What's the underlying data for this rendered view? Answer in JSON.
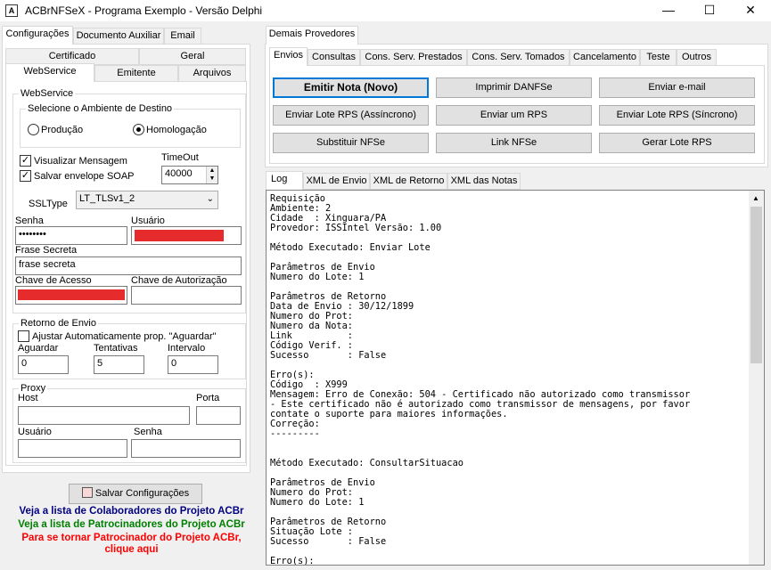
{
  "window": {
    "title": "ACBrNFSeX - Programa Exemplo - Versão Delphi",
    "icon": "app-icon"
  },
  "left": {
    "top_tabs": [
      "Configurações",
      "Documento Auxiliar",
      "Email"
    ],
    "sub_tabs_row1": [
      "Certificado",
      "Geral"
    ],
    "sub_tabs_row2": [
      "WebService",
      "Emitente",
      "Arquivos"
    ],
    "webservice_group": "WebService",
    "ambiente_group": "Selecione o Ambiente de Destino",
    "producao": "Produção",
    "homologacao": "Homologação",
    "visualizar": "Visualizar Mensagem",
    "salvar_envelope": "Salvar envelope SOAP",
    "timeout_label": "TimeOut",
    "timeout_value": "40000",
    "ssltype_label": "SSLType",
    "ssltype_value": "LT_TLSv1_2",
    "senha_label": "Senha",
    "senha_value": "••••••••",
    "usuario_label": "Usuário",
    "frase_label": "Frase Secreta",
    "frase_value": "frase secreta",
    "chave_acesso_label": "Chave de Acesso",
    "chave_autorizacao_label": "Chave de Autorização",
    "retorno_group": "Retorno de Envio",
    "ajustar": "Ajustar Automaticamente prop. \"Aguardar\"",
    "aguardar_label": "Aguardar",
    "aguardar_value": "0",
    "tentativas_label": "Tentativas",
    "tentativas_value": "5",
    "intervalo_label": "Intervalo",
    "intervalo_value": "0",
    "proxy_group": "Proxy",
    "host_label": "Host",
    "porta_label": "Porta",
    "proxy_usuario_label": "Usuário",
    "proxy_senha_label": "Senha",
    "salvar_config": "Salvar Configurações",
    "link1": "Veja a lista de Colaboradores do Projeto ACBr",
    "link2": "Veja a lista de Patrocinadores do Projeto ACBr",
    "link3a": "Para se tornar Patrocinador do Projeto ACBr,",
    "link3b": "clique aqui",
    "colors": {
      "link1": "#000080",
      "link2": "#008000",
      "link3": "#ff0000",
      "redacted": "#e52b2b"
    }
  },
  "right": {
    "provider_tab": "Demais Provedores",
    "action_tabs": [
      "Envios",
      "Consultas",
      "Cons. Serv. Prestados",
      "Cons. Serv. Tomados",
      "Cancelamento",
      "Teste",
      "Outros"
    ],
    "buttons": [
      [
        "Emitir Nota (Novo)",
        "Imprimir DANFSe",
        "Enviar e-mail"
      ],
      [
        "Enviar Lote RPS (Assíncrono)",
        "Enviar um RPS",
        "Enviar Lote RPS (Síncrono)"
      ],
      [
        "Substituir NFSe",
        "Link NFSe",
        "Gerar Lote RPS"
      ]
    ],
    "log_tabs": [
      "Log",
      "XML de Envio",
      "XML de Retorno",
      "XML das Notas"
    ],
    "log_text": "Requisição\nAmbiente: 2\nCidade  : Xinguara/PA\nProvedor: ISSIntel Versão: 1.00\n\nMétodo Executado: Enviar Lote\n\nParâmetros de Envio\nNumero do Lote: 1\n\nParâmetros de Retorno\nData de Envio : 30/12/1899\nNumero do Prot:\nNumero da Nota:\nLink          :\nCódigo Verif. :\nSucesso       : False\n\nErro(s):\nCódigo  : X999\nMensagem: Erro de Conexão: 504 - Certificado não autorizado como transmissor\n- Este certificado não é autorizado como transmissor de mensagens, por favor\ncontate o suporte para maiores informações.\nCorreção:\n---------\n\n\nMétodo Executado: ConsultarSituacao\n\nParâmetros de Envio\nNumero do Prot:\nNumero do Lote: 1\n\nParâmetros de Retorno\nSituação Lote :\nSucesso       : False\n\nErro(s):"
  }
}
